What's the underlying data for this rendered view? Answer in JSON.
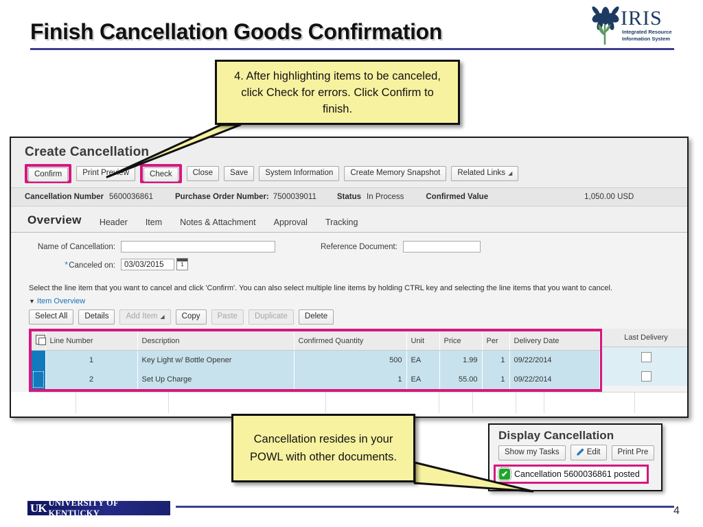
{
  "slide": {
    "title": "Finish Cancellation Goods Confirmation",
    "page_number": "4",
    "accent_color": "#3b3f8c",
    "highlight_color": "#d5177f",
    "callout_fill": "#f7f2a0"
  },
  "logo": {
    "name": "IRIS",
    "tagline_line1": "Integrated Resource",
    "tagline_line2": "Information System",
    "color": "#1d3a63"
  },
  "footer": {
    "uk_mark": "UK",
    "uk_name": "UNIVERSITY OF KENTUCKY"
  },
  "callouts": [
    {
      "id": "callout-top",
      "text": "4. After highlighting items to be canceled, click Check for errors. Click Confirm to finish."
    },
    {
      "id": "callout-bottom",
      "text": "Cancellation resides in your POWL with other documents."
    }
  ],
  "app": {
    "title": "Create Cancellation",
    "toolbar": [
      {
        "label": "Confirm",
        "highlighted": true,
        "disabled": false
      },
      {
        "label": "Print Preview",
        "highlighted": false,
        "disabled": false
      },
      {
        "label": "Check",
        "highlighted": true,
        "disabled": false
      },
      {
        "label": "Close",
        "highlighted": false,
        "disabled": false
      },
      {
        "label": "Save",
        "highlighted": false,
        "disabled": false
      },
      {
        "label": "System Information",
        "highlighted": false,
        "disabled": false
      },
      {
        "label": "Create Memory Snapshot",
        "highlighted": false,
        "disabled": false
      },
      {
        "label": "Related Links",
        "highlighted": false,
        "disabled": false,
        "menu": true
      }
    ],
    "info": {
      "cancellation_number_label": "Cancellation Number",
      "cancellation_number_value": "5600036861",
      "purchase_order_label": "Purchase Order Number:",
      "purchase_order_value": "7500039011",
      "status_label": "Status",
      "status_value": "In Process",
      "confirmed_value_label": "Confirmed Value",
      "confirmed_value_value": "1,050.00 USD"
    },
    "tabs": [
      {
        "label": "Overview",
        "active": true
      },
      {
        "label": "Header",
        "active": false
      },
      {
        "label": "Item",
        "active": false
      },
      {
        "label": "Notes & Attachment",
        "active": false
      },
      {
        "label": "Approval",
        "active": false
      },
      {
        "label": "Tracking",
        "active": false
      }
    ],
    "form": {
      "name_of_cancellation_label": "Name of Cancellation:",
      "name_of_cancellation_value": "",
      "reference_document_label": "Reference Document:",
      "reference_document_value": "",
      "canceled_on_label": "Canceled on:",
      "canceled_on_value": "03/03/2015",
      "required_marker": "*"
    },
    "hint": "Select the line item that you want to cancel and click 'Confirm'. You can also select multiple line items by holding CTRL key and selecting the line items that you want to cancel.",
    "item_overview_label": "Item Overview",
    "item_toolbar": [
      {
        "label": "Select All",
        "disabled": false,
        "menu": false
      },
      {
        "label": "Details",
        "disabled": false,
        "menu": false
      },
      {
        "label": "Add Item",
        "disabled": true,
        "menu": true
      },
      {
        "label": "Copy",
        "disabled": false,
        "menu": false
      },
      {
        "label": "Paste",
        "disabled": true,
        "menu": false
      },
      {
        "label": "Duplicate",
        "disabled": true,
        "menu": false
      },
      {
        "label": "Delete",
        "disabled": false,
        "menu": false
      }
    ],
    "table": {
      "columns": [
        "Line Number",
        "Description",
        "Confirmed Quantity",
        "Unit",
        "Price",
        "Per",
        "Delivery Date"
      ],
      "right_column": "Last Delivery",
      "rows": [
        {
          "line_number": "1",
          "description": "Key Light w/ Bottle Opener",
          "confirmed_quantity": "500",
          "unit": "EA",
          "price": "1.99",
          "per": "1",
          "delivery_date": "09/22/2014",
          "last_delivery_checked": false,
          "selected": true
        },
        {
          "line_number": "2",
          "description": "Set Up Charge",
          "confirmed_quantity": "1",
          "unit": "EA",
          "price": "55.00",
          "per": "1",
          "delivery_date": "09/22/2014",
          "last_delivery_checked": false,
          "selected": true
        }
      ]
    }
  },
  "display_cancellation": {
    "title": "Display Cancellation",
    "toolbar": [
      {
        "label": "Show my Tasks",
        "icon": ""
      },
      {
        "label": "Edit",
        "icon": "pencil-icon"
      },
      {
        "label": "Print Pre",
        "icon": ""
      }
    ],
    "message": "Cancellation 5600036861 posted",
    "message_icon": "success-check-icon"
  }
}
